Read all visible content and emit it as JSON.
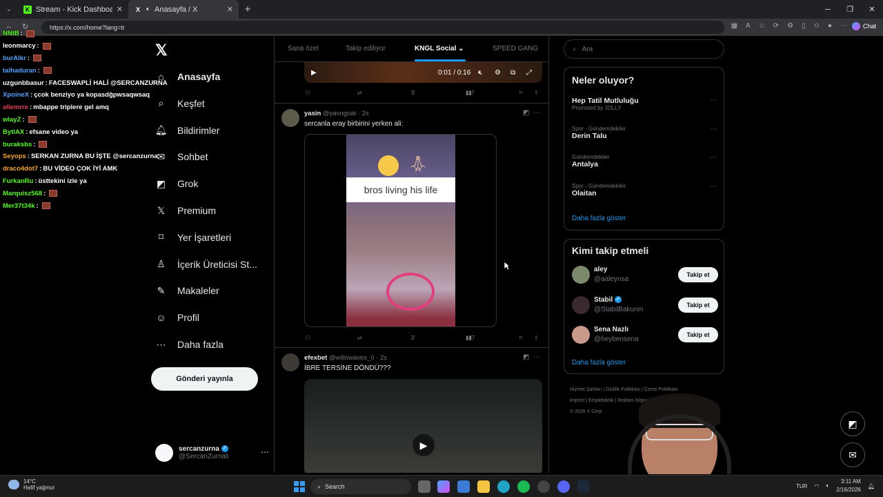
{
  "browser": {
    "tabs": [
      {
        "title": "Stream - Kick Dashboard",
        "favicon": "K",
        "color": "#53fc18"
      },
      {
        "title": "Anasayfa / X",
        "favicon": "X",
        "color": "#000000"
      }
    ],
    "url": "https://x.com/home?lang=tr",
    "chat_label": "Chat"
  },
  "overlay_chat": [
    {
      "user": "NNtB",
      "color": "#53fc18",
      "text": "",
      "emote": true
    },
    {
      "user": "leonmarcy",
      "color": "#ffffff",
      "text": "",
      "emote": true
    },
    {
      "user": "burAlkr",
      "color": "#4da3ff",
      "text": "",
      "emote": true
    },
    {
      "user": "talhaduran",
      "color": "#4da3ff",
      "text": "",
      "emote": true
    },
    {
      "user": "uzgunbbasur",
      "color": "#ffffff",
      "text": "FACESWAPLİ HALİ @SERCANZURNA",
      "emote": false
    },
    {
      "user": "XpoineX",
      "color": "#4da3ff",
      "text": "çcok benziyo ya kopasdğpwsaqwsaq",
      "emote": false
    },
    {
      "user": "allemrre",
      "color": "#e23d5a",
      "text": "mbappe triplere gel amq",
      "emote": false
    },
    {
      "user": "wlayZ",
      "color": "#53fc18",
      "text": "",
      "emote": true
    },
    {
      "user": "BytlAX",
      "color": "#53fc18",
      "text": "efsane video ya",
      "emote": false
    },
    {
      "user": "buraksbs",
      "color": "#53fc18",
      "text": "",
      "emote": true
    },
    {
      "user": "Seyops",
      "color": "#f5a623",
      "text": "SERKAN ZURNA BU İŞTE @sercanzurna",
      "emote": false
    },
    {
      "user": "draco4dot7",
      "color": "#f5a623",
      "text": "BU VİDEO ÇOK İYİ AMK",
      "emote": false
    },
    {
      "user": "FurkanRu",
      "color": "#53fc18",
      "text": "üsttekini izle ya",
      "emote": false
    },
    {
      "user": "Marquisz568",
      "color": "#53fc18",
      "text": "",
      "emote": true
    },
    {
      "user": "Mer37t34k",
      "color": "#53fc18",
      "text": "",
      "emote": true
    }
  ],
  "nav": {
    "items": [
      {
        "label": "Anasayfa",
        "icon": "home-icon",
        "glyph": "⌂"
      },
      {
        "label": "Keşfet",
        "icon": "search-icon",
        "glyph": "⌕"
      },
      {
        "label": "Bildirimler",
        "icon": "bell-icon",
        "glyph": "🔔︎"
      },
      {
        "label": "Sohbet",
        "icon": "mail-icon",
        "glyph": "✉"
      },
      {
        "label": "Grok",
        "icon": "grok-icon",
        "glyph": "◩"
      },
      {
        "label": "Premium",
        "icon": "x-logo-icon",
        "glyph": "𝕏"
      },
      {
        "label": "Yer İşaretleri",
        "icon": "bookmark-icon",
        "glyph": "⌑"
      },
      {
        "label": "İçerik Üreticisi St...",
        "icon": "creator-icon",
        "glyph": "♙"
      },
      {
        "label": "Makaleler",
        "icon": "article-icon",
        "glyph": "✎"
      },
      {
        "label": "Profil",
        "icon": "person-icon",
        "glyph": "☺"
      },
      {
        "label": "Daha fazla",
        "icon": "more-icon",
        "glyph": "⋯"
      }
    ],
    "post_button": "Gönderi yayınla",
    "account": {
      "name": "sercanzurna",
      "handle": "@SercanZurnali"
    }
  },
  "timeline": {
    "tabs": [
      "Sana özel",
      "Takip ediliyor",
      "KNGL Social",
      "SPEED GANG"
    ],
    "active_tab": "KNGL Social",
    "top_video": {
      "time": "0:01 / 0:16"
    },
    "top_actions": {
      "reposts": "",
      "likes": "3",
      "views": "117"
    },
    "post1": {
      "name": "yasin",
      "handle": "@yasngoat",
      "time": "2s",
      "text": "sercanla eray birbirini yerken ali:",
      "caption": "bros living his life",
      "actions": {
        "likes": "2",
        "views": "197"
      }
    },
    "post2": {
      "name": "efexbet",
      "handle": "@willowaves_0",
      "time": "2s",
      "text": "İBRE TERSİNE DÖNDÜ???"
    }
  },
  "right": {
    "search_placeholder": "Ara",
    "trends_title": "Neler oluyor?",
    "trends": [
      {
        "meta": "Promoted by JOLLY",
        "name": "Hep Tatil Mutluluğu"
      },
      {
        "meta": "Spor · Gündemdekiler",
        "name": "Derin Talu"
      },
      {
        "meta": "Gündemdekiler",
        "name": "Antalya"
      },
      {
        "meta": "Spor · Gündemdekiler",
        "name": "Olaitan"
      }
    ],
    "show_more": "Daha fazla göster",
    "follow_title": "Kimi takip etmeli",
    "follow": [
      {
        "name": "aley",
        "handle": "@aaleynsa",
        "verified": false,
        "color": "#7a8a6a"
      },
      {
        "name": "Stabil",
        "handle": "@StabilBakunin",
        "verified": true,
        "color": "#3a2a30"
      },
      {
        "name": "Sena Nazlı",
        "handle": "@heybensena",
        "verified": false,
        "color": "#c99a8a"
      }
    ],
    "follow_button": "Takip et",
    "footer": [
      "Hizmet Şartları",
      "Gizlilik Politikası",
      "Çerez Politikası",
      "Imprint",
      "Erişilebilirlik",
      "Reklam bilgisi",
      "Daha fazla",
      "© 2026 X Corp."
    ]
  },
  "taskbar": {
    "temp": "14°C",
    "weather": "Hafif yağmur",
    "search": "Search",
    "lang": "TUR",
    "time": "3:11 AM",
    "date": "2/16/2026"
  }
}
